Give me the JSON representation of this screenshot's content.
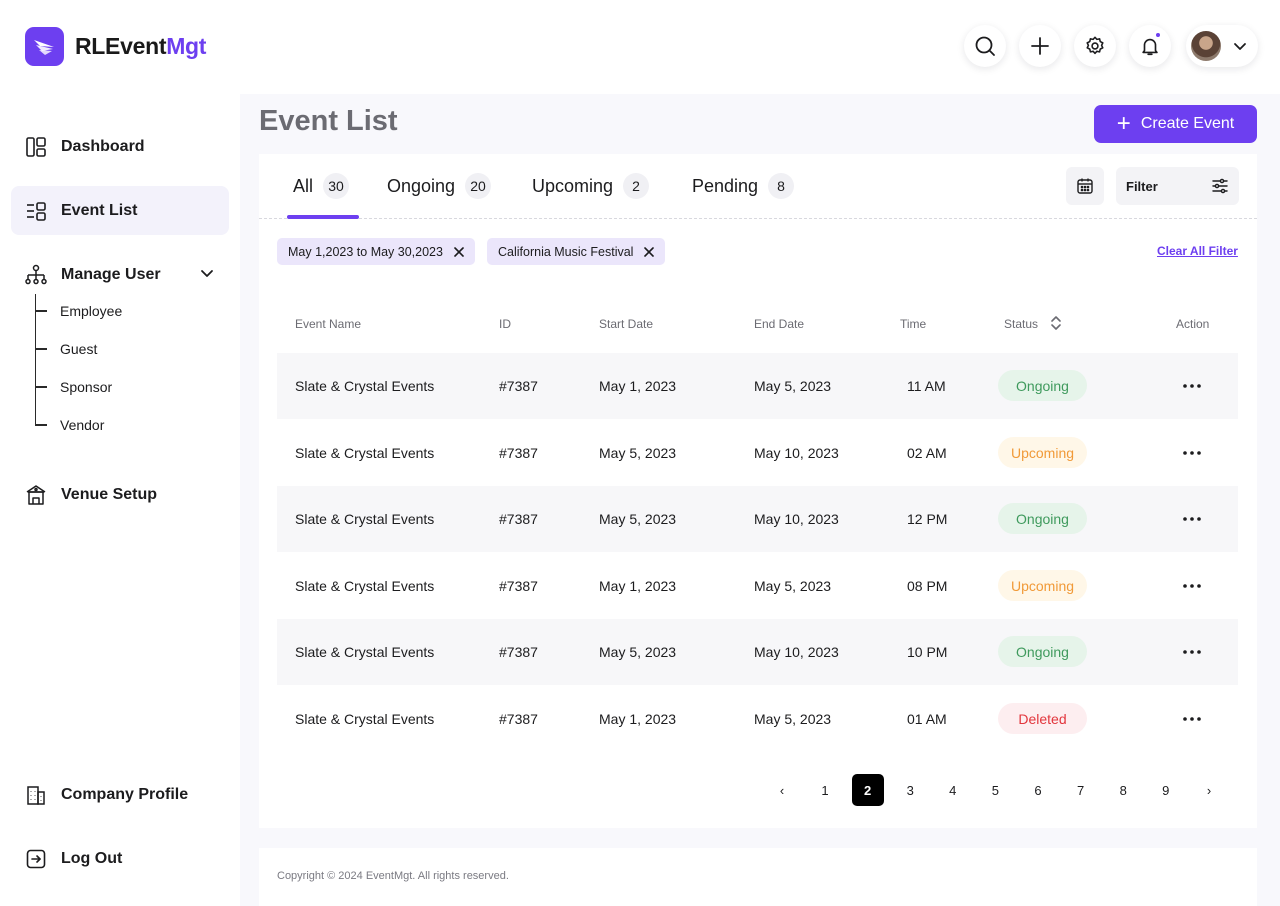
{
  "brand": {
    "name_part1": "RLEvent",
    "name_part2": "Mgt",
    "accent": "#6d3ff0"
  },
  "header": {
    "icons": [
      "search-icon",
      "plus-icon",
      "gear-icon",
      "bell-icon",
      "avatar",
      "chevron-down-icon"
    ]
  },
  "sidebar": {
    "items": [
      {
        "label": "Dashboard",
        "icon": "dashboard-icon"
      },
      {
        "label": "Event List",
        "icon": "event-list-icon",
        "active": true
      },
      {
        "label": "Manage User",
        "icon": "org-chart-icon"
      },
      {
        "label": "Venue Setup",
        "icon": "venue-icon"
      },
      {
        "label": "Company Profile",
        "icon": "building-icon"
      },
      {
        "label": "Log Out",
        "icon": "logout-icon"
      }
    ],
    "sub_items": [
      "Employee",
      "Guest",
      "Sponsor",
      "Vendor"
    ]
  },
  "main": {
    "title": "Event List",
    "create_button": "Create Event",
    "tabs": [
      {
        "label": "All",
        "count": "30"
      },
      {
        "label": "Ongoing",
        "count": "20"
      },
      {
        "label": "Upcoming",
        "count": "2"
      },
      {
        "label": "Pending",
        "count": "8"
      }
    ],
    "filter_label": "Filter",
    "chips": [
      "May 1,2023 to May 30,2023",
      "California Music Festival"
    ],
    "clear_filter": "Clear All Filter",
    "columns": [
      "Event Name",
      "ID",
      "Start Date",
      "End Date",
      "Time",
      "Status",
      "Action"
    ],
    "rows": [
      {
        "name": "Slate & Crystal Events",
        "id": "#7387",
        "start": "May 1, 2023",
        "end": "May 5, 2023",
        "time": "11 AM",
        "status": "Ongoing"
      },
      {
        "name": "Slate & Crystal Events",
        "id": "#7387",
        "start": "May 5, 2023",
        "end": "May 10, 2023",
        "time": "02 AM",
        "status": "Upcoming"
      },
      {
        "name": "Slate & Crystal Events",
        "id": "#7387",
        "start": "May 5, 2023",
        "end": "May 10, 2023",
        "time": "12 PM",
        "status": "Ongoing"
      },
      {
        "name": "Slate & Crystal Events",
        "id": "#7387",
        "start": "May 1, 2023",
        "end": "May 5, 2023",
        "time": "08 PM",
        "status": "Upcoming"
      },
      {
        "name": "Slate & Crystal Events",
        "id": "#7387",
        "start": "May 5, 2023",
        "end": "May 10, 2023",
        "time": "10 PM",
        "status": "Ongoing"
      },
      {
        "name": "Slate & Crystal Events",
        "id": "#7387",
        "start": "May 1, 2023",
        "end": "May 5, 2023",
        "time": "01 AM",
        "status": "Deleted"
      }
    ],
    "pagination": {
      "prev": "‹",
      "next": "›",
      "pages": [
        "1",
        "2",
        "3",
        "4",
        "5",
        "6",
        "7",
        "8",
        "9"
      ],
      "current": "2"
    }
  },
  "footer": {
    "text": "Copyright © 2024 EventMgt. All rights reserved."
  }
}
